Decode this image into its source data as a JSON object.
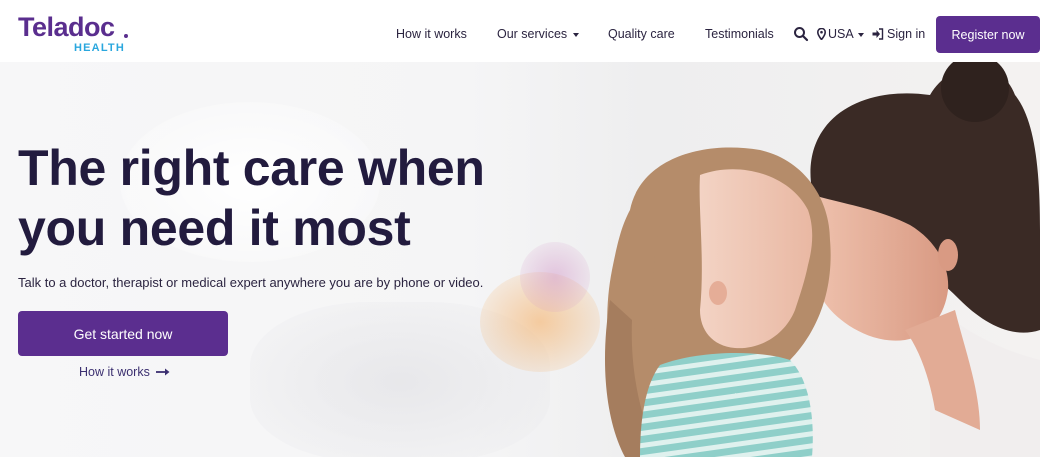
{
  "brand": {
    "name": "Teladoc",
    "sub": "HEALTH",
    "primary_color": "#5b2e8f",
    "accent_color": "#2aa7de"
  },
  "nav": {
    "items": [
      {
        "label": "How it works"
      },
      {
        "label": "Our services"
      },
      {
        "label": "Quality care"
      },
      {
        "label": "Testimonials"
      }
    ],
    "country": "USA",
    "signin": "Sign in",
    "register": "Register now",
    "icons": [
      "search-icon",
      "location-pin-icon",
      "chevron-down-icon",
      "sign-in-icon"
    ]
  },
  "hero": {
    "headline": "The right care when you need it most",
    "subtext": "Talk to a doctor, therapist or medical expert anywhere you are by phone or video.",
    "cta": "Get started now",
    "secondary_link": "How it works",
    "secondary_icon": "arrow-right-icon"
  }
}
